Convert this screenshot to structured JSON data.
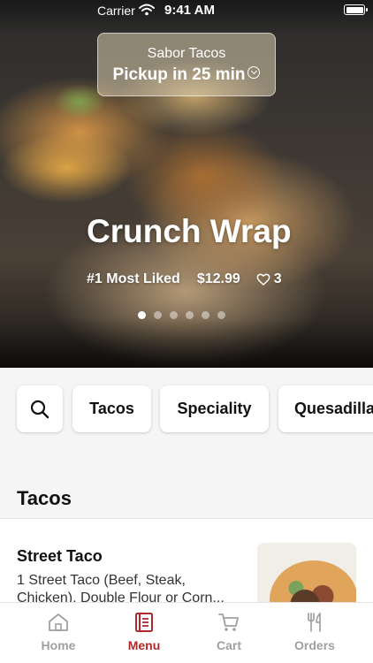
{
  "status_bar": {
    "carrier": "Carrier",
    "time": "9:41 AM"
  },
  "header": {
    "store_name": "Sabor Tacos",
    "pickup_text": "Pickup in 25 min"
  },
  "hero": {
    "title": "Crunch Wrap",
    "badge": "#1 Most Liked",
    "price": "$12.99",
    "likes": "3",
    "slide_count": 6,
    "active_slide": 0
  },
  "categories": {
    "items": [
      "Tacos",
      "Speciality",
      "Quesadillas"
    ]
  },
  "section": {
    "title": "Tacos"
  },
  "menu_item": {
    "name": "Street Taco",
    "description": "1 Street Taco (Beef, Steak, Chicken), Double Flour or Corn..."
  },
  "tabbar": {
    "tabs": [
      {
        "label": "Home",
        "icon": "home-icon",
        "active": false
      },
      {
        "label": "Menu",
        "icon": "menu-icon",
        "active": true
      },
      {
        "label": "Cart",
        "icon": "cart-icon",
        "active": false
      },
      {
        "label": "Orders",
        "icon": "fork-knife-icon",
        "active": false
      }
    ]
  },
  "colors": {
    "accent": "#b0282b",
    "inactive": "#a0a0a0",
    "background": "#f5f5f5"
  }
}
